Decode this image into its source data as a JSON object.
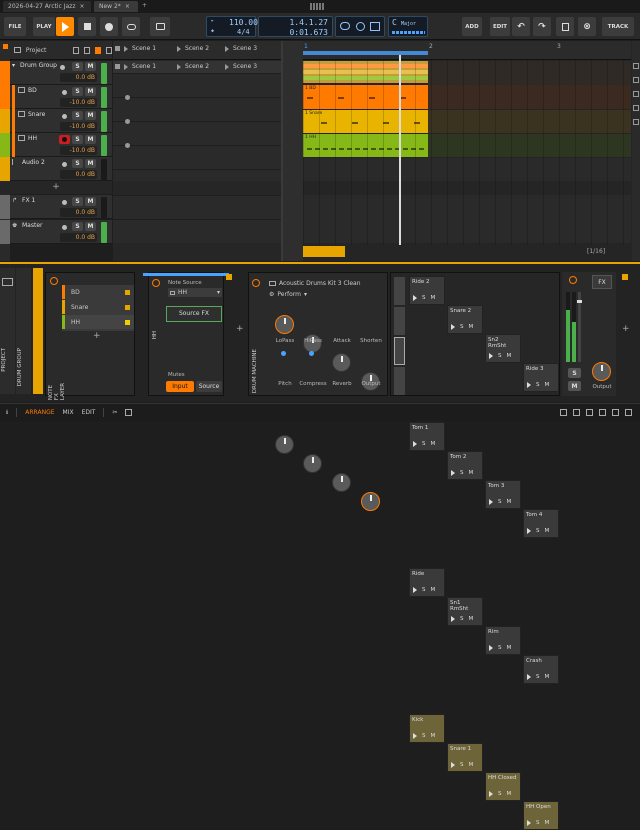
{
  "window": {
    "tab1": "2026-04-27 Arctic Jazz",
    "tab2": "New 2*",
    "close": "×",
    "add_tab": "+"
  },
  "transport": {
    "file": "FILE",
    "play": "PLAY",
    "tempo": "110.00",
    "signature": "4/4",
    "position": "1.4.1.27",
    "time": "0:01.673",
    "key": "C",
    "key_mode": "Major",
    "add": "ADD",
    "edit": "EDIT",
    "track": "TRACK"
  },
  "inspector": {
    "project": "Project"
  },
  "tracks": [
    {
      "name": "Drum Group",
      "vol": "0.0 dB",
      "color": "#ff7a00"
    },
    {
      "name": "BD",
      "vol": "-10.0 dB",
      "color": "#ff7a00"
    },
    {
      "name": "Snare",
      "vol": "-10.0 dB",
      "color": "#e8a500"
    },
    {
      "name": "HH",
      "vol": "-10.0 dB",
      "color": "#86b818"
    },
    {
      "name": "Audio 2",
      "vol": "0.0 dB",
      "color": "#e8a500"
    },
    {
      "name": "FX 1",
      "vol": "0.0 dB",
      "color": "#888"
    },
    {
      "name": "Master",
      "vol": "0.0 dB",
      "color": "#888"
    }
  ],
  "scenes": [
    "Scene 1",
    "Scene 2",
    "Scene 3"
  ],
  "solo": "S",
  "mute": "M",
  "arranger": {
    "bar1": "1",
    "bar2": "2",
    "bar3": "3",
    "page": "[1/16]",
    "clip_bd": "1 BD",
    "clip_snare": "1 Snare",
    "clip_hh": "1 HH"
  },
  "left_panel": {
    "project": "PROJECT",
    "drum_group": "DRUM GROUP"
  },
  "note_fx": {
    "title": "NOTE FX LAYER",
    "layers": [
      "BD",
      "Snare",
      "HH"
    ]
  },
  "hh": {
    "title": "HH",
    "note_source": "Note Source",
    "source_sel": "HH",
    "source_fx": "Source FX",
    "mutes": "Mutes",
    "input": "Input",
    "source": "Source"
  },
  "drum_machine": {
    "title": "DRUM MACHINE",
    "preset": "Acoustic Drums Kit 3 Clean",
    "perform": "Perform",
    "knobs": [
      "LoPass",
      "HiPass",
      "Attack",
      "Shorten",
      "Pitch",
      "Compress",
      "Reverb",
      "Output"
    ]
  },
  "pads": [
    {
      "name": "Ride 2",
      "active": false
    },
    {
      "name": "Snare 2",
      "active": false
    },
    {
      "name": "Sn2 RmSht",
      "active": false
    },
    {
      "name": "Ride 3",
      "active": false
    },
    {
      "name": "Tom 1",
      "active": false
    },
    {
      "name": "Tom 2",
      "active": false
    },
    {
      "name": "Tom 3",
      "active": false
    },
    {
      "name": "Tom 4",
      "active": false
    },
    {
      "name": "Ride",
      "active": false
    },
    {
      "name": "Sn1 RmSht",
      "active": false
    },
    {
      "name": "Rim",
      "active": false
    },
    {
      "name": "Crash",
      "active": false
    },
    {
      "name": "Kick",
      "active": true
    },
    {
      "name": "Snare 1",
      "active": true
    },
    {
      "name": "HH Closed",
      "active": true
    },
    {
      "name": "HH Open",
      "active": true
    }
  ],
  "mixer_right": {
    "fx": "FX",
    "s": "S",
    "m": "M",
    "output": "Output"
  },
  "statusbar": {
    "arrange": "ARRANGE",
    "mix": "MIX",
    "edit": "EDIT"
  },
  "accent": "#ff7a00"
}
